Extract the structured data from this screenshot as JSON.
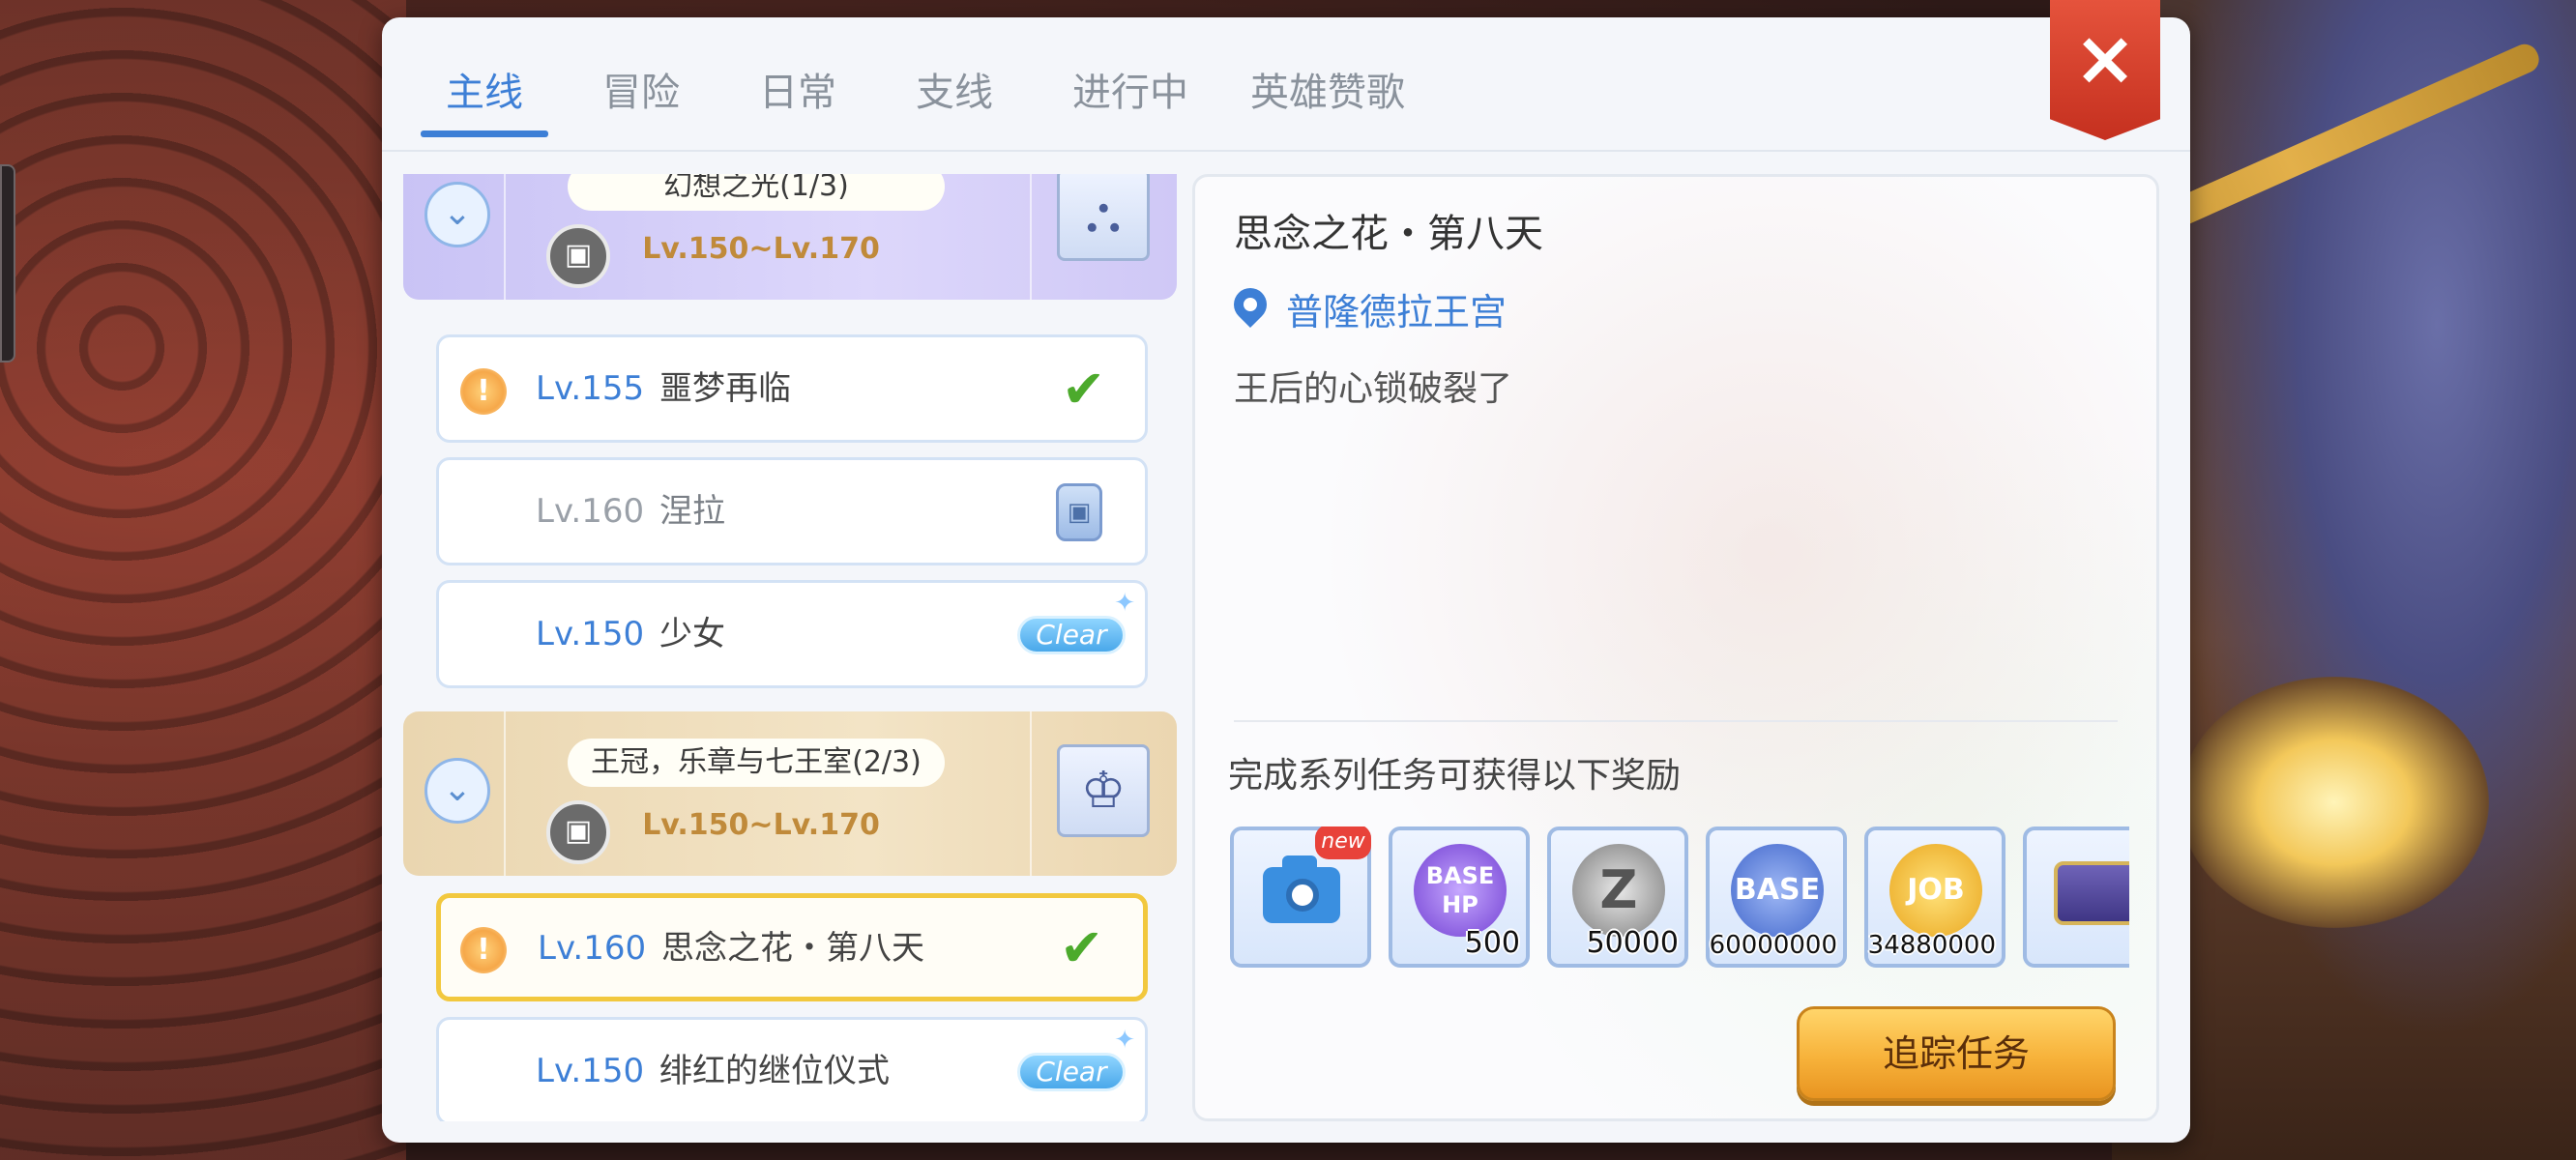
{
  "tabs": [
    "主线",
    "冒险",
    "日常",
    "支线",
    "进行中",
    "英雄赞歌"
  ],
  "active_tab_index": 0,
  "close_symbol": "×",
  "chapters": [
    {
      "title": "幻想之光(1/3)",
      "level_range": "Lv.150~Lv.170",
      "theme": "purple",
      "quests": [
        {
          "level": "Lv.155",
          "name": "噩梦再临",
          "status": "completed",
          "alert": true
        },
        {
          "level": "Lv.160",
          "name": "涅拉",
          "status": "locked",
          "alert": false
        },
        {
          "level": "Lv.150",
          "name": "少女",
          "status": "clear",
          "alert": false
        }
      ]
    },
    {
      "title": "王冠，乐章与七王室(2/3)",
      "level_range": "Lv.150~Lv.170",
      "theme": "gold",
      "quests": [
        {
          "level": "Lv.160",
          "name": "思念之花・第八天",
          "status": "completed",
          "alert": true,
          "selected": true
        },
        {
          "level": "Lv.150",
          "name": "绯红的继位仪式",
          "status": "clear",
          "alert": false
        }
      ]
    }
  ],
  "status_labels": {
    "clear": "Clear",
    "alert": "!",
    "check": "✔",
    "lock": "🔒",
    "chevron": "⌄",
    "gallery": "▣"
  },
  "detail": {
    "title": "思念之花・第八天",
    "location": "普隆德拉王宫",
    "description": "王后的心锁破裂了",
    "reward_label": "完成系列任务可获得以下奖励",
    "rewards": [
      {
        "icon": "camera-icon",
        "badge": "new",
        "qty": ""
      },
      {
        "icon": "base-hp-icon",
        "label": "BASE HP",
        "qty": "500"
      },
      {
        "icon": "zeny-icon",
        "label": "Z",
        "qty": "50000"
      },
      {
        "icon": "base-exp-icon",
        "label": "BASE",
        "qty": "60000000"
      },
      {
        "icon": "job-exp-icon",
        "label": "JOB",
        "qty": "34880000"
      },
      {
        "icon": "treasure-chest-icon",
        "label": "",
        "qty": ""
      }
    ],
    "track_button": "追踪任务"
  },
  "colors": {
    "accent_blue": "#3d7fd6",
    "selected_border": "#f2c83e",
    "close_red": "#d3412c",
    "track_orange": "#f7b23a"
  }
}
